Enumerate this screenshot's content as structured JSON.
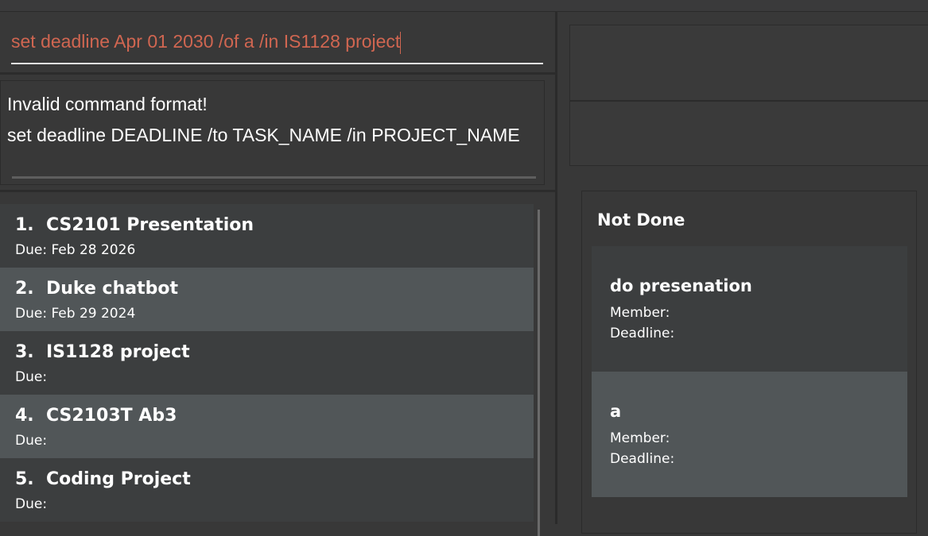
{
  "command_box": {
    "input_value": "set deadline Apr 01 2030 /of a /in IS1128 project"
  },
  "result_display": {
    "lines": [
      "Invalid command format!",
      "set deadline DEADLINE /to TASK_NAME /in PROJECT_NAME"
    ]
  },
  "project_list": {
    "items": [
      {
        "index": "1.",
        "name": "CS2101 Presentation",
        "due": "Due: Feb 28 2026"
      },
      {
        "index": "2.",
        "name": "Duke chatbot",
        "due": "Due: Feb 29 2024"
      },
      {
        "index": "3.",
        "name": "IS1128 project",
        "due": "Due:"
      },
      {
        "index": "4.",
        "name": "CS2103T Ab3",
        "due": "Due:"
      },
      {
        "index": "5.",
        "name": "Coding Project",
        "due": "Due:"
      }
    ]
  },
  "task_board": {
    "column_title": "Not Done",
    "tasks": [
      {
        "name": "do presenation",
        "member_label": "Member:",
        "deadline_label": "Deadline:"
      },
      {
        "name": "a",
        "member_label": "Member:",
        "deadline_label": "Deadline:"
      }
    ]
  },
  "colors": {
    "background": "#383838",
    "command_text_error": "#d06651",
    "row_light": "#515658",
    "row_dark": "#3c3e3f"
  }
}
